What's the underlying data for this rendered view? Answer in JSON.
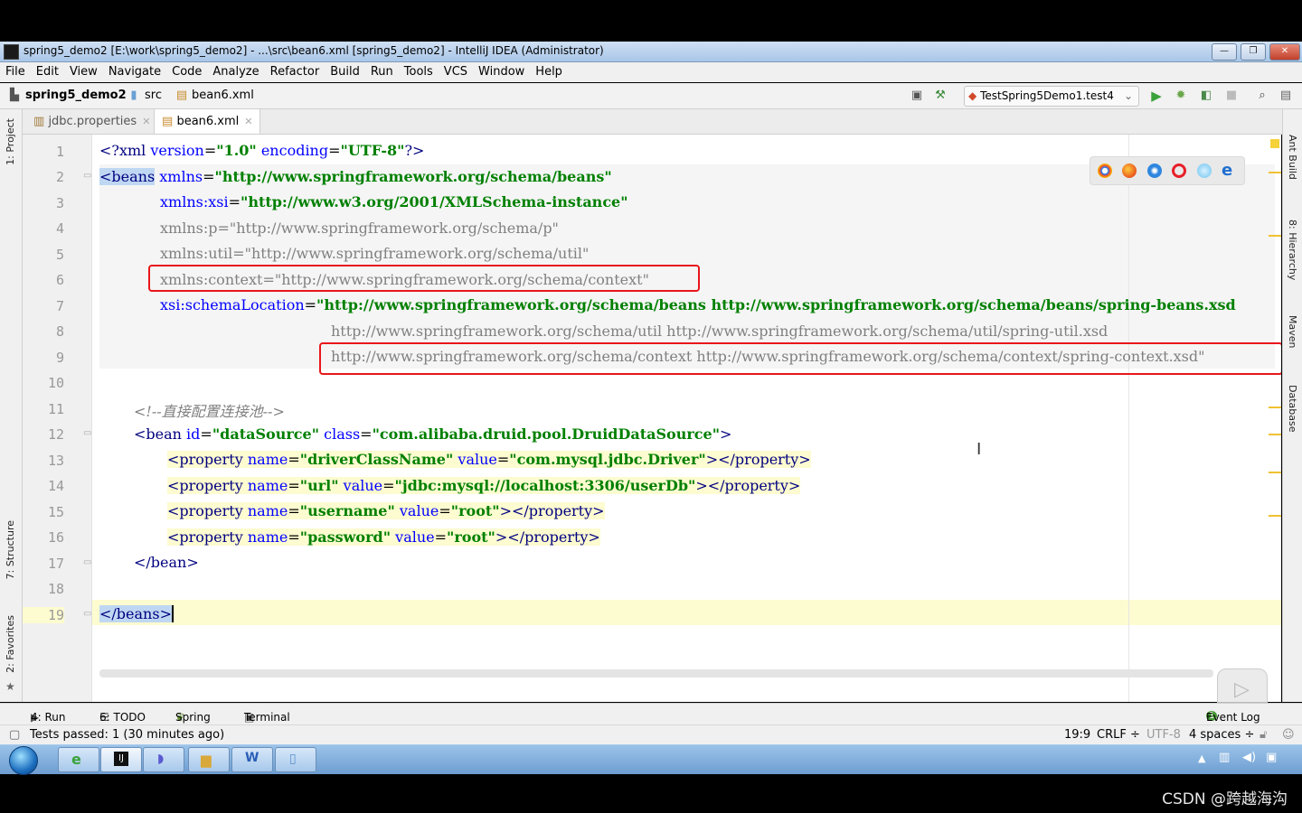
{
  "window": {
    "title": "spring5_demo2 [E:\\work\\spring5_demo2] - ...\\src\\bean6.xml [spring5_demo2] - IntelliJ IDEA (Administrator)",
    "minimize": "—",
    "restore": "❐",
    "close": "✕"
  },
  "menu": [
    "File",
    "Edit",
    "View",
    "Navigate",
    "Code",
    "Analyze",
    "Refactor",
    "Build",
    "Run",
    "Tools",
    "VCS",
    "Window",
    "Help"
  ],
  "breadcrumb": {
    "project": "spring5_demo2",
    "folder": "src",
    "file": "bean6.xml"
  },
  "run_config": "TestSpring5Demo1.test4",
  "tabs": [
    {
      "label": "jdbc.properties",
      "active": false
    },
    {
      "label": "bean6.xml",
      "active": true
    }
  ],
  "left_tools": [
    "1: Project",
    "7: Structure",
    "2: Favorites"
  ],
  "right_tools": [
    "Ant Build",
    "8: Hierarchy",
    "Maven",
    "Database"
  ],
  "line_numbers": [
    "1",
    "2",
    "3",
    "4",
    "5",
    "6",
    "7",
    "8",
    "9",
    "10",
    "11",
    "12",
    "13",
    "14",
    "15",
    "16",
    "17",
    "18",
    "19"
  ],
  "code": {
    "l1": {
      "a": "<?xml ",
      "b": "version",
      "c": "=",
      "d": "\"1.0\"",
      "e": " ",
      "f": "encoding",
      "g": "=",
      "h": "\"UTF-8\"",
      "i": "?>"
    },
    "l2": {
      "a": "<beans",
      "b": " xmlns",
      "c": "=",
      "d": "\"http://www.springframework.org/schema/beans\""
    },
    "l3": {
      "a": "xmlns:xsi",
      "b": "=",
      "c": "\"http://www.w3.org/2001/XMLSchema-instance\""
    },
    "l4": "xmlns:p=\"http://www.springframework.org/schema/p\"",
    "l5": "xmlns:util=\"http://www.springframework.org/schema/util\"",
    "l6": "xmlns:context=\"http://www.springframework.org/schema/context\"",
    "l7": {
      "a": "xsi:schemaLocation",
      "b": "=",
      "c": "\"http://www.springframework.org/schema/beans http://www.springframework.org/schema/beans/spring-beans.xsd"
    },
    "l8": "http://www.springframework.org/schema/util http://www.springframework.org/schema/util/spring-util.xsd",
    "l9": "http://www.springframework.org/schema/context http://www.springframework.org/schema/context/spring-context.xsd\"",
    "l11": "<!--直接配置连接池-->",
    "l12": {
      "a": "<bean",
      "b": " id",
      "c": "=",
      "d": "\"dataSource\"",
      "e": " class",
      "f": "=",
      "g": "\"com.alibaba.druid.pool.DruidDataSource\"",
      "h": ">"
    },
    "l13": {
      "a": "<property",
      "b": " name",
      "c": "=",
      "d": "\"driverClassName\"",
      "e": " value",
      "f": "=",
      "g": "\"com.mysql.jdbc.Driver\"",
      "h": "></property>"
    },
    "l14": {
      "a": "<property",
      "b": " name",
      "c": "=",
      "d": "\"url\"",
      "e": " value",
      "f": "=",
      "g": "\"jdbc:mysql://localhost:3306/userDb\"",
      "h": "></property>"
    },
    "l15": {
      "a": "<property",
      "b": " name",
      "c": "=",
      "d": "\"username\"",
      "e": " value",
      "f": "=",
      "g": "\"root\"",
      "h": "></property>"
    },
    "l16": {
      "a": "<property",
      "b": " name",
      "c": "=",
      "d": "\"password\"",
      "e": " value",
      "f": "=",
      "g": "\"root\"",
      "h": "></property>"
    },
    "l17": "</bean>",
    "l19": "</beans>"
  },
  "bottom_tools": [
    "4: Run",
    "6: TODO",
    "Spring",
    "Terminal",
    "Event Log"
  ],
  "status": {
    "message": "Tests passed: 1 (30 minutes ago)",
    "position": "19:9",
    "line_sep": "CRLF ÷",
    "encoding": "UTF-8",
    "indent": "4 spaces ÷"
  },
  "watermark": "CSDN @跨越海沟",
  "colors": {
    "highlight_box": "#e8161b",
    "tag": "#000080",
    "attr": "#0000ff",
    "value": "#008000"
  }
}
